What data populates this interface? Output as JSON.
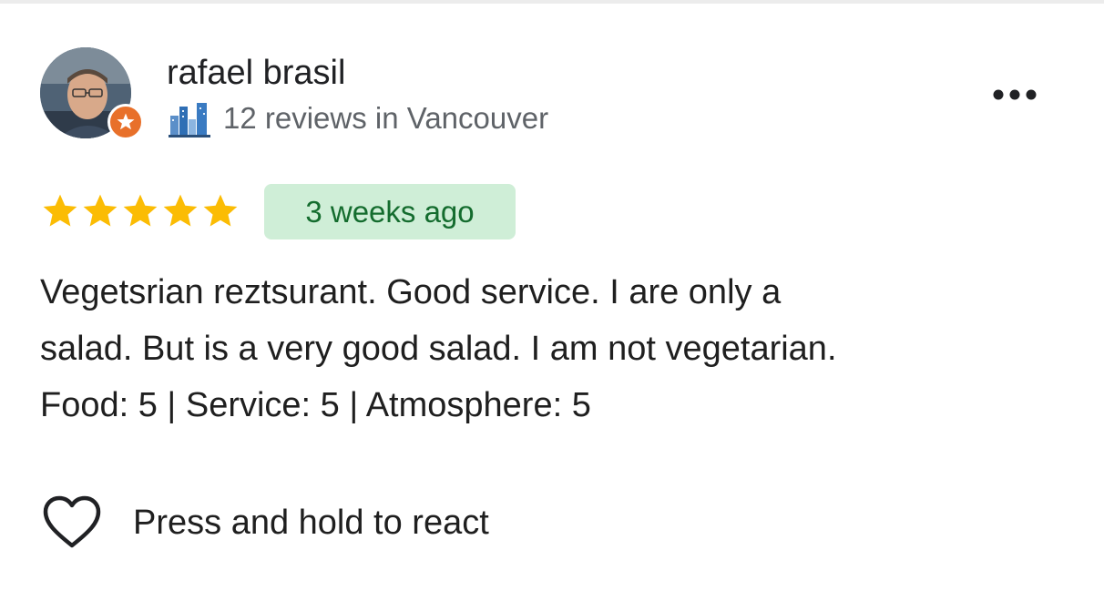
{
  "reviewer": {
    "name": "rafael brasil",
    "reviews_summary": "12 reviews in Vancouver",
    "badge_icon": "local-guide-star-icon",
    "city_icon": "city-skyline-icon",
    "avatar": "profile-photo"
  },
  "menu": {
    "icon": "more-options-icon"
  },
  "rating": {
    "stars": 5,
    "max_stars": 5,
    "star_color": "#fbbc04"
  },
  "timestamp": {
    "label": "3 weeks ago",
    "badge_color": "#cfeed7",
    "text_color": "#146c2e"
  },
  "review": {
    "line1": "Vegetsrian reztsurant. Good service. I are only a",
    "line2": "salad. But is a very good salad. I am not vegetarian.",
    "line3": "Food: 5 | Service: 5 | Atmosphere: 5"
  },
  "reaction": {
    "label": "Press and hold to react",
    "icon": "heart-outline-icon"
  }
}
